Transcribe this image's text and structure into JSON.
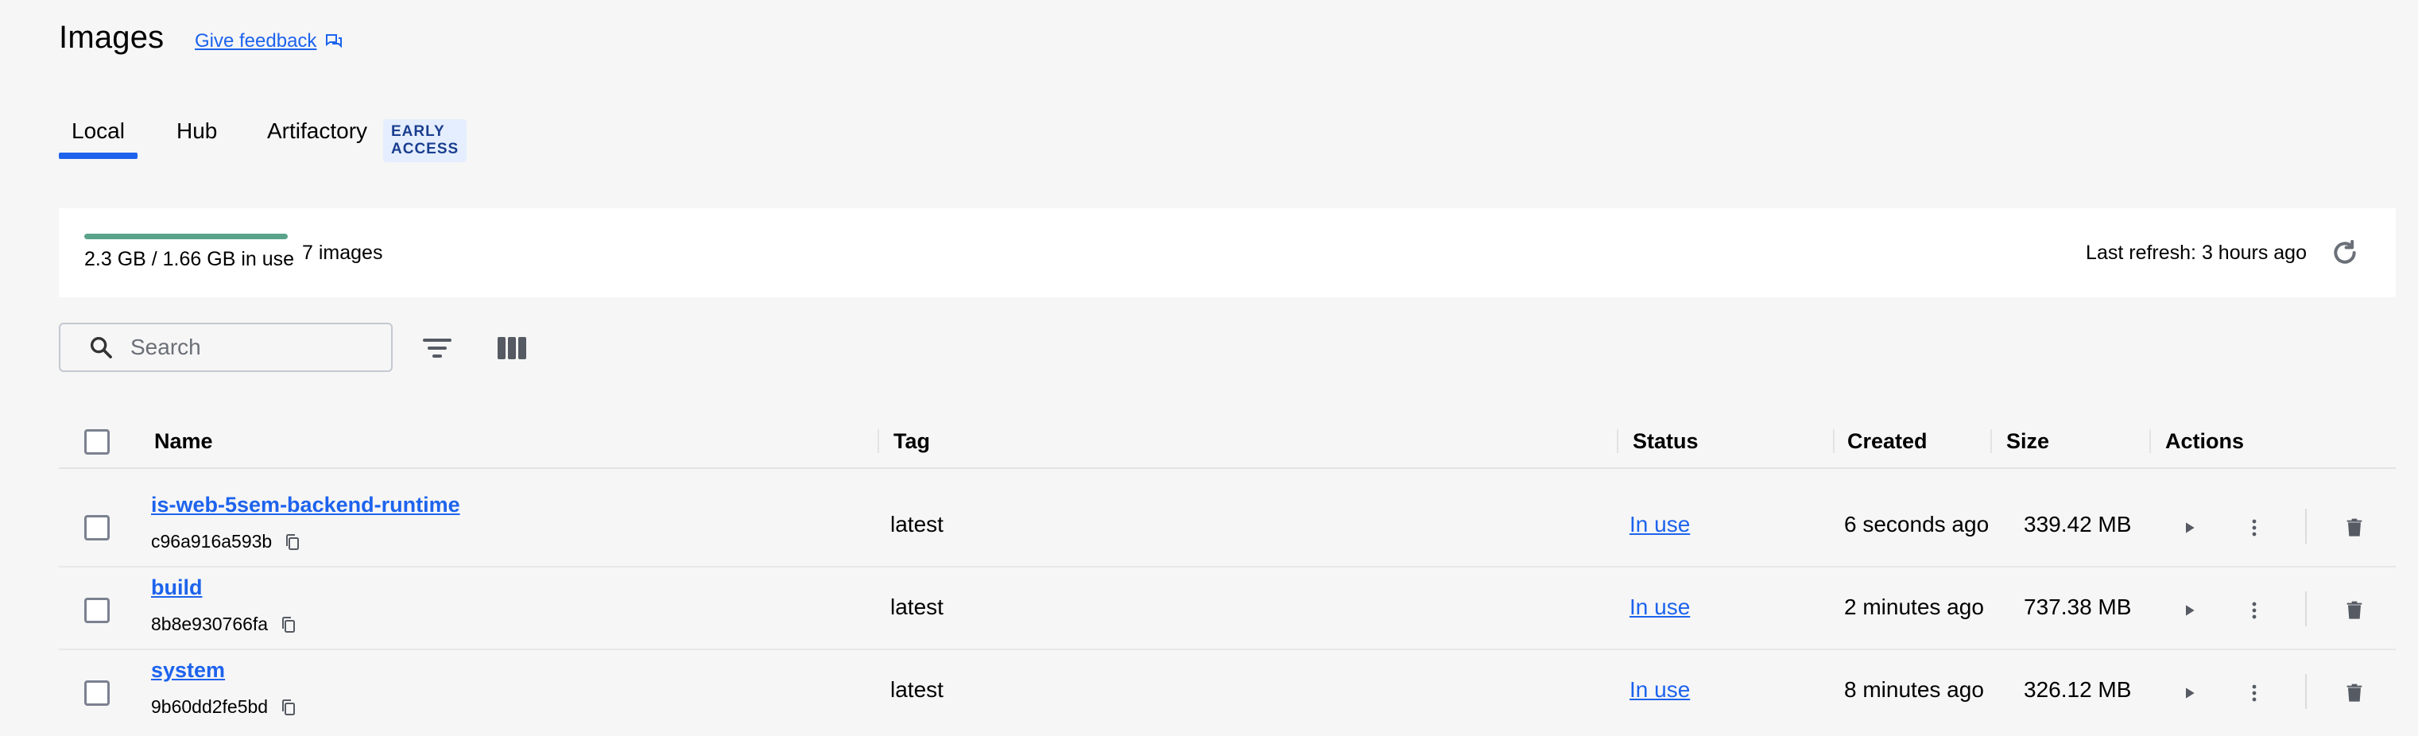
{
  "page": {
    "title": "Images",
    "feedback_label": "Give feedback"
  },
  "tabs": [
    {
      "label": "Local",
      "active": true
    },
    {
      "label": "Hub",
      "active": false
    },
    {
      "label": "Artifactory",
      "active": false,
      "badge": "EARLY ACCESS"
    }
  ],
  "summary": {
    "usage_text": "2.3 GB / 1.66 GB in use",
    "usage_fraction": 1.0,
    "image_count": "7 images",
    "last_refresh": "Last refresh: 3 hours ago"
  },
  "search": {
    "placeholder": "Search"
  },
  "table": {
    "headers": {
      "name": "Name",
      "tag": "Tag",
      "status": "Status",
      "created": "Created",
      "size": "Size",
      "actions": "Actions"
    },
    "rows": [
      {
        "name": "is-web-5sem-backend-runtime",
        "id": "c96a916a593b",
        "tag": "latest",
        "status": "In use",
        "created": "6 seconds ago",
        "size": "339.42 MB"
      },
      {
        "name": "build",
        "id": "8b8e930766fa",
        "tag": "latest",
        "status": "In use",
        "created": "2 minutes ago",
        "size": "737.38 MB"
      },
      {
        "name": "system",
        "id": "9b60dd2fe5bd",
        "tag": "latest",
        "status": "In use",
        "created": "8 minutes ago",
        "size": "326.12 MB"
      }
    ]
  },
  "colors": {
    "accent": "#1d63ed",
    "usage_bar": "#5aa38b",
    "background": "#f6f6f6"
  },
  "icons": {
    "feedback": "feedback-icon",
    "refresh": "refresh-icon",
    "search": "search-icon",
    "filter": "filter-icon",
    "columns": "columns-icon",
    "copy": "copy-icon",
    "run": "play-icon",
    "more": "more-vertical-icon",
    "delete": "trash-icon"
  }
}
